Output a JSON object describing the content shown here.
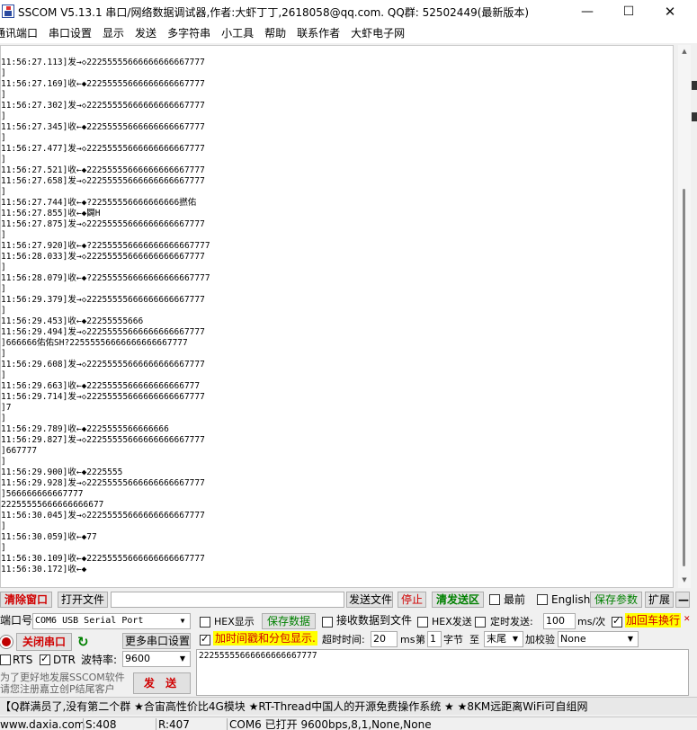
{
  "titlebar": {
    "title": "SSCOM V5.13.1 串口/网络数据调试器,作者:大虾丁丁,2618058@qq.com. QQ群: 52502449(最新版本)",
    "minimize": "—",
    "maximize": "☐",
    "close": "✕"
  },
  "menu": [
    "通讯端口",
    "串口设置",
    "显示",
    "发送",
    "多字符串",
    "小工具",
    "帮助",
    "联系作者",
    "大虾电子网"
  ],
  "receive": {
    "lines": [
      "11:56:27.113]发→◇22255555666666666667777",
      "",
      "11:56:27.169]收←◆22255555666666666667777",
      "",
      "11:56:27.302]发→◇22255555666666666667777",
      "",
      "11:56:27.345]收←◆22255555666666666667777",
      "",
      "11:56:27.477]发→◇22255555666666666667777",
      "",
      "11:56:27.521]收←◆22255555666666666667777",
      "11:56:27.658]发→◇22255555666666666667777",
      "",
      "11:56:27.744]收←◆?22555556666666666撚佑",
      "11:56:27.855]收←◆闢H",
      "11:56:27.875]发→◇22255555666666666667777",
      "",
      "11:56:27.920]收←◆?22555556666666666667777",
      "11:56:28.033]发→◇22255555666666666667777",
      "",
      "11:56:28.079]收←◆?22555556666666666667777",
      "",
      "11:56:29.379]发→◇22255555666666666667777",
      "",
      "11:56:29.453]收←◆22255555666",
      "11:56:29.494]发→◇22255555666666666667777",
      "]666666佑佑SH?22555556666666666667777",
      "",
      "11:56:29.608]发→◇22255555666666666667777",
      "",
      "11:56:29.663]收←◆2225555566666666666777",
      "11:56:29.714]发→◇22255555666666666667777",
      "]7",
      "",
      "11:56:29.789]收←◆2225555566666666",
      "11:56:29.827]发→◇22255555666666666667777",
      "]667777",
      "",
      "11:56:29.900]收←◆2225555",
      "11:56:29.928]发→◇22255555666666666667777",
      "]566666666667777",
      "22255555666666666677",
      "11:56:30.045]发→◇22255555666666666667777",
      "",
      "11:56:30.059]收←◆77",
      "",
      "11:56:30.109]收←◆22255555666666666667777",
      "11:56:30.172]收←◆"
    ]
  },
  "toolbar": {
    "clear_window": "清除窗口",
    "open_file": "打开文件",
    "file_path": "",
    "send_file": "发送文件",
    "stop": "停止",
    "clear_send": "清发送区",
    "topmost": "最前",
    "english": "English",
    "save_params": "保存参数",
    "expand": "扩展",
    "minus": "—"
  },
  "port": {
    "label": "端口号",
    "value": "COM6 USB Serial Port",
    "hex_display": "HEX显示",
    "save_data": "保存数据",
    "recv_to_file": "接收数据到文件",
    "hex_send": "HEX发送",
    "timed_send": "定时发送:",
    "interval": "100",
    "ms_per": "ms/次",
    "crlf": "加回车换行",
    "close_port": "关闭串口",
    "more_settings": "更多串口设置",
    "timestamp": "加时间戳和分包显示.",
    "timeout_label": "超时时间:",
    "timeout": "20",
    "ms": "ms",
    "di": "第",
    "byte_num": "1",
    "byte_label": "字节",
    "to": "至",
    "end": "末尾",
    "check_label": "加校验",
    "check": "None",
    "rts": "RTS",
    "dtr": "DTR",
    "baud_label": "波特率:",
    "baud": "9600",
    "send_text": "22255555666666666667777",
    "send_btn": "发 送"
  },
  "promo": {
    "line1": "为了更好地发展SSCOM软件",
    "line2": "请您注册嘉立创P结尾客户"
  },
  "ticker": "【Q群满员了,没有第二个群 ★合宙高性价比4G模块 ★RT-Thread中国人的开源免费操作系统 ★ ★8KM远距离WiFi可自组网",
  "status": {
    "site": "www.daxia.com",
    "sent": "S:408",
    "recv": "R:407",
    "port_status": "COM6 已打开  9600bps,8,1,None,None"
  },
  "colors": {
    "accent_red": "#d00000",
    "accent_green": "#008000",
    "highlight": "#ffff00"
  }
}
